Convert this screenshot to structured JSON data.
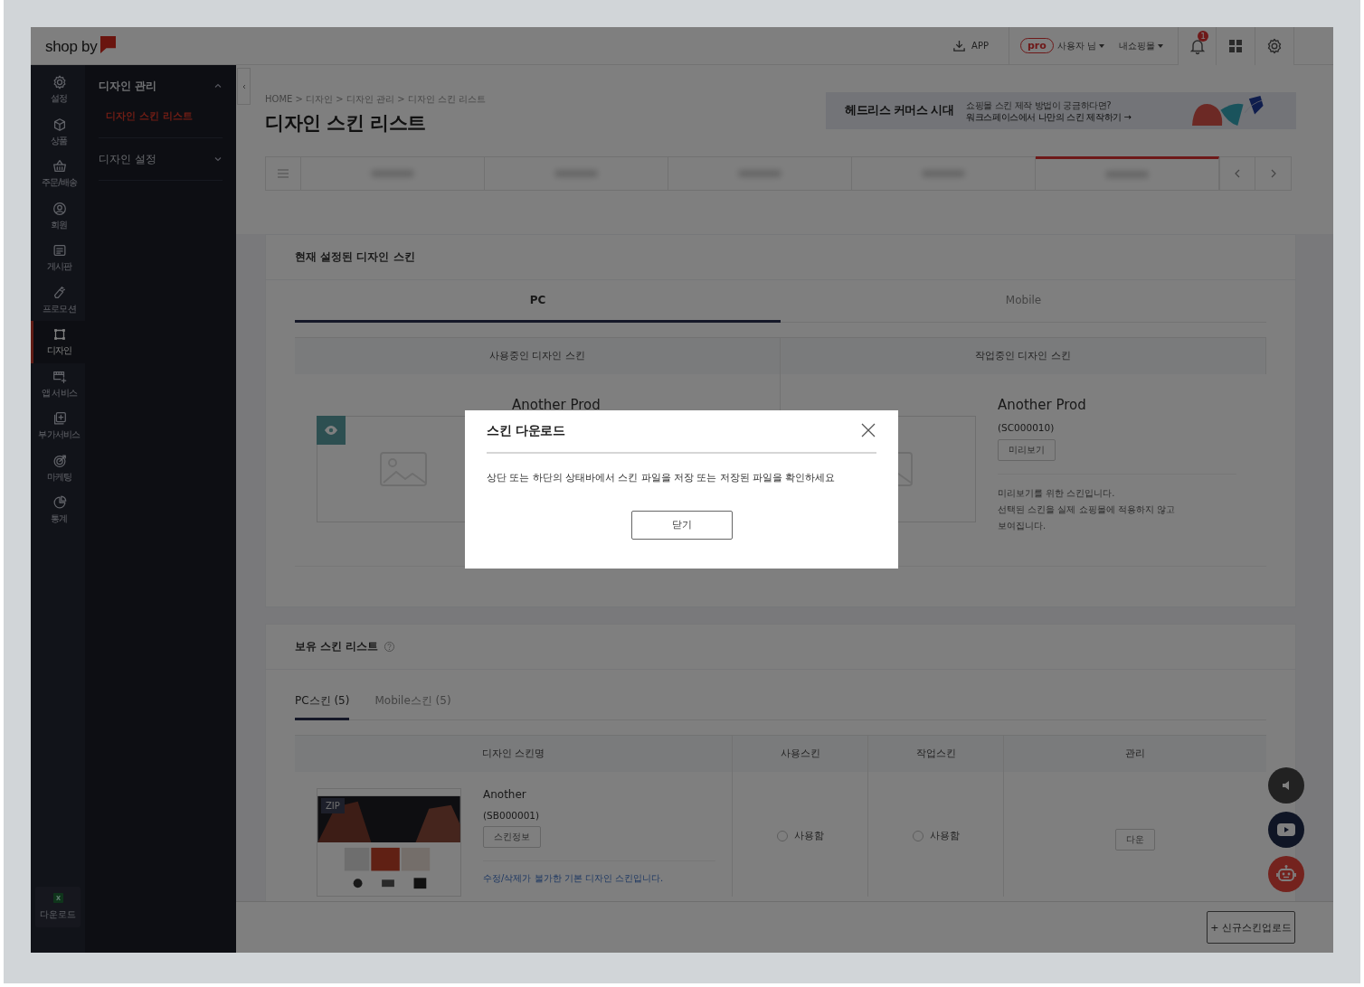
{
  "topbar": {
    "logo": "shop by",
    "app_link": "APP",
    "plan_badge": "pro",
    "user_menu": "사용자 님",
    "mall_menu": "내쇼핑몰",
    "notification_count": "1"
  },
  "nav_rail": [
    {
      "label": "설정",
      "selected": false
    },
    {
      "label": "상품",
      "selected": false
    },
    {
      "label": "주문/배송",
      "selected": false
    },
    {
      "label": "회원",
      "selected": false
    },
    {
      "label": "게시판",
      "selected": false
    },
    {
      "label": "프로모션",
      "selected": false
    },
    {
      "label": "디자인",
      "selected": true
    },
    {
      "label": "앱 서비스",
      "selected": false
    },
    {
      "label": "부가서비스",
      "selected": false
    },
    {
      "label": "마케팅",
      "selected": false
    },
    {
      "label": "통계",
      "selected": false
    }
  ],
  "nav_download": "다운로드",
  "submenu": [
    {
      "label": "디자인 관리",
      "expanded": true,
      "children": [
        {
          "label": "디자인 스킨 리스트",
          "selected": true
        }
      ]
    },
    {
      "label": "디자인 설정",
      "expanded": false
    }
  ],
  "breadcrumb": "HOME > 디자인 > 디자인 관리 > 디자인 스킨 리스트",
  "page_title": "디자인 스킨 리스트",
  "banner": {
    "headline": "헤드리스 커머스 시대",
    "subtitle": "쇼핑몰 스킨 제작 방법이 궁금하다면?",
    "link": "워크스페이스에서 나만의 스킨 제작하기 →"
  },
  "page_tabs": [
    {
      "selected": false
    },
    {
      "selected": false
    },
    {
      "selected": false
    },
    {
      "selected": false
    },
    {
      "selected": true
    }
  ],
  "current_skin": {
    "title": "현재 설정된 디자인 스킨",
    "tabs": [
      {
        "label": "PC",
        "selected": true
      },
      {
        "label": "Mobile",
        "selected": false
      }
    ],
    "columns": [
      "사용중인 디자인 스킨",
      "작업중인 디자인 스킨"
    ],
    "in_use": {
      "name": "Another Prod"
    },
    "working": {
      "name": "Another Prod",
      "code": "(SC000010)",
      "preview_button": "미리보기",
      "note": [
        "미리보기를 위한 스킨입니다.",
        "선택된 스킨을 실제 쇼핑몰에 적용하지 않고",
        "보여집니다."
      ]
    }
  },
  "owned_skins": {
    "title": "보유 스킨 리스트",
    "tabs": [
      {
        "label": "PC스킨 (5)",
        "selected": true
      },
      {
        "label": "Mobile스킨 (5)",
        "selected": false
      }
    ],
    "columns": [
      "디자인 스킨명",
      "사용스킨",
      "작업스킨",
      "관리"
    ],
    "rows": [
      {
        "badge": "ZIP",
        "name": "Another",
        "code": "(SB000001)",
        "info_button": "스킨정보",
        "note": "수정/삭제가 불가한 기본 디자인 스킨입니다.",
        "use_label": "사용함",
        "use_checked": false,
        "work_label": "사용함",
        "work_checked": false,
        "manage_button": "다운"
      }
    ]
  },
  "upload_button": "+ 신규스킨업로드",
  "dialog": {
    "title": "스킨 다운로드",
    "message": "상단 또는 하단의 상태바에서 스킨 파일을 저장 또는 저장된 파일을 확인하세요",
    "close_button": "닫기"
  }
}
